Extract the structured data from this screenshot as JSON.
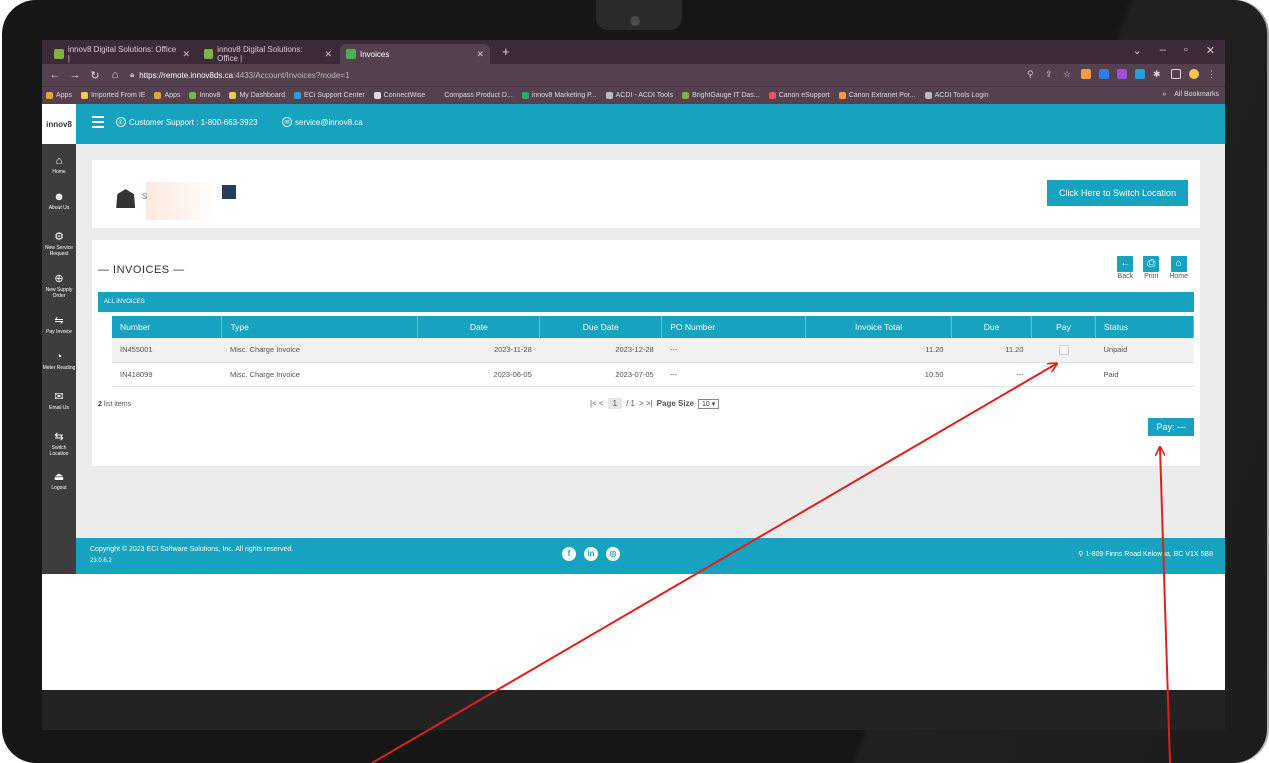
{
  "browser": {
    "tabs": [
      {
        "title": "innov8 Digital Solutions: Office |"
      },
      {
        "title": "innov8 Digital Solutions: Office |"
      },
      {
        "title": "Invoices"
      }
    ],
    "url_host": "https://remote.innov8ds.ca",
    "url_path": ":4433/Account/Invoices?mode=1",
    "bookmarks": [
      {
        "label": "Apps",
        "color": "#e8a23a"
      },
      {
        "label": "Imported From IE",
        "color": "#f2c94c"
      },
      {
        "label": "Apps",
        "color": "#e8a23a"
      },
      {
        "label": "Innov8",
        "color": "#7cb342"
      },
      {
        "label": "My Dashboard",
        "color": "#f2c94c"
      },
      {
        "label": "ECi Support Center",
        "color": "#2d9cdb"
      },
      {
        "label": "ConnectWise",
        "color": "#dddddd"
      },
      {
        "label": "Compass Product D...",
        "color": "#55404f"
      },
      {
        "label": "innov8 Marketing P...",
        "color": "#27ae60"
      },
      {
        "label": "ACDI - ACDI Tools",
        "color": "#bbbbbb"
      },
      {
        "label": "BrightGauge IT Das...",
        "color": "#7cb342"
      },
      {
        "label": "Canon eSupport",
        "color": "#eb5757"
      },
      {
        "label": "Canon Extranet Por...",
        "color": "#f2994a"
      },
      {
        "label": "ACDI Tools Login",
        "color": "#bbbbbb"
      }
    ],
    "all_bookmarks": "All Bookmarks"
  },
  "header": {
    "logo": "innov8",
    "support": "Customer Support : 1-800-663-3923",
    "email": "service@innov8.ca"
  },
  "sidebar": {
    "items": [
      {
        "label": "Home",
        "icon": "home-icon"
      },
      {
        "label": "About Us",
        "icon": "user-icon"
      },
      {
        "label": "New Service Request",
        "icon": "service-icon"
      },
      {
        "label": "New Supply Order",
        "icon": "supply-icon"
      },
      {
        "label": "Pay Invoice",
        "icon": "handshake-icon"
      },
      {
        "label": "Meter Reading",
        "icon": "meter-icon"
      },
      {
        "label": "Email Us",
        "icon": "mail-icon"
      },
      {
        "label": "Switch Location",
        "icon": "switch-icon"
      },
      {
        "label": "Logout",
        "icon": "logout-icon"
      }
    ]
  },
  "location": {
    "fragment": "S",
    "switch_button": "Click Here to Switch Location"
  },
  "invoices": {
    "title": "— INVOICES —",
    "actions": {
      "back": "Back",
      "print": "Print",
      "home": "Home"
    },
    "section_label": "ALL INVOICES",
    "columns": [
      "Number",
      "Type",
      "Date",
      "Due Date",
      "PO Number",
      "Invoice Total",
      "Due",
      "Pay",
      "Status"
    ],
    "rows": [
      {
        "number": "IN455001",
        "type": "Misc. Charge Invoice",
        "date": "2023-11-28",
        "due_date": "2023-12-28",
        "po": "---",
        "total": "11.20",
        "due": "11.20",
        "status": "Unpaid"
      },
      {
        "number": "IN418099",
        "type": "Misc. Charge Invoice",
        "date": "2023-06-05",
        "due_date": "2023-07-05",
        "po": "---",
        "total": "10.50",
        "due": "---",
        "status": "Paid"
      }
    ],
    "list_count": "2",
    "list_count_suffix": "list items",
    "pager_prev": "|< <",
    "page": "1",
    "page_of": "/ 1",
    "pager_next": "> >|",
    "page_size_label": "Page Size",
    "page_size": "10",
    "pay_button": "Pay: ---"
  },
  "footer": {
    "copyright": "Copyright © 2023 ECI Software Solutions, Inc. All rights reserved.",
    "version": "23.0.6.2",
    "address": "1-809 Finns Road Kelowna, BC V1X 5B8"
  },
  "colors": {
    "accent": "#17a2c0",
    "sidebar": "#3d3d3d",
    "annotation": "#e0201c"
  }
}
